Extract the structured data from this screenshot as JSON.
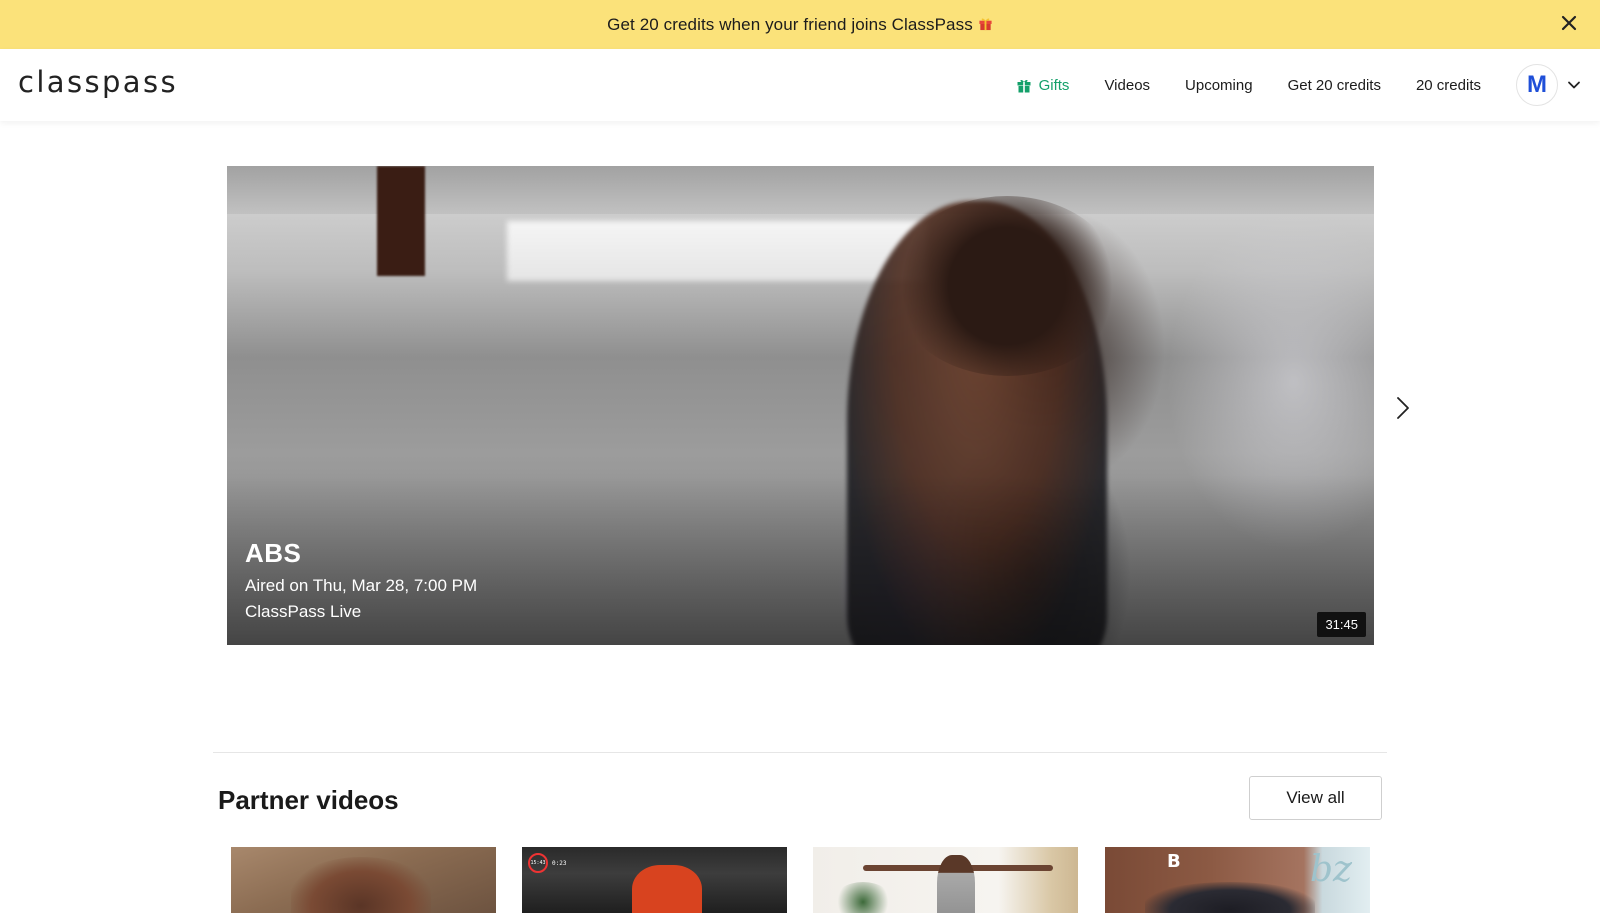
{
  "promo": {
    "text": "Get 20 credits when your friend joins ClassPass",
    "gift_icon": "gift-emoji-icon",
    "close_icon": "close-icon",
    "background": "#fbe27a"
  },
  "header": {
    "logo": "classpass",
    "nav": {
      "gifts": "Gifts",
      "videos": "Videos",
      "upcoming": "Upcoming",
      "get_credits": "Get 20 credits",
      "credits": "20 credits"
    },
    "gifts_color": "#14a06a",
    "avatar_initial": "M",
    "avatar_color": "#1f4fd8"
  },
  "hero": {
    "title": "ABS",
    "aired": "Aired on Thu, Mar 28, 7:00 PM",
    "source": "ClassPass Live",
    "duration": "31:45",
    "next_icon": "chevron-right-icon"
  },
  "partner_section": {
    "title": "Partner videos",
    "view_all": "View all",
    "thumbnails": [
      {
        "name": "partner-video-1"
      },
      {
        "name": "partner-video-2",
        "hud_time": "15:43",
        "hud_sub": "0:23"
      },
      {
        "name": "partner-video-3"
      },
      {
        "name": "partner-video-4",
        "overlay_text": "B",
        "overlay_script": "bz"
      }
    ]
  }
}
